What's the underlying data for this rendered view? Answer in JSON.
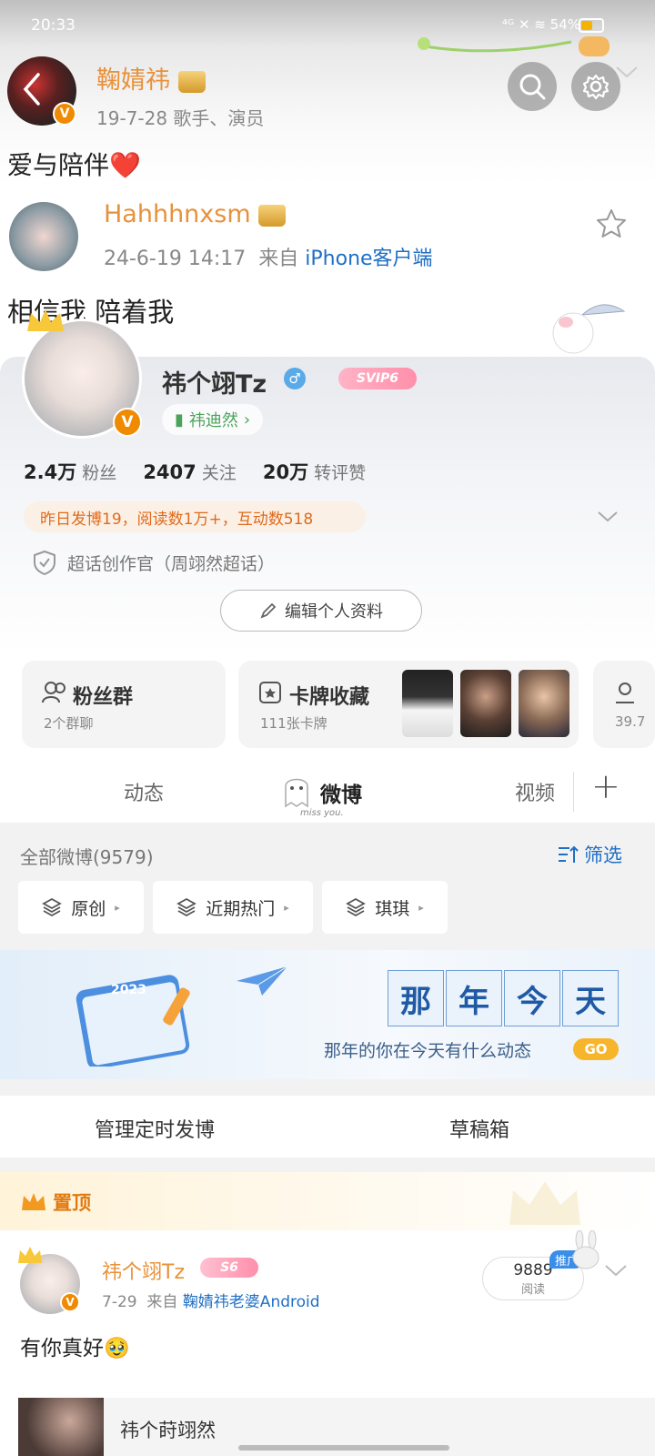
{
  "status_bar": {
    "time": "20:33",
    "indicators": "⁴ᴳ  ✕  ≋ 54%"
  },
  "header": {
    "user": {
      "name": "鞠婧祎",
      "meta": "19-7-28  歌手、演员",
      "avatar_icon": "avatar-photo"
    },
    "status_text": "爱与陪伴❤️"
  },
  "repost": {
    "user": {
      "name": "Hahhhnxsm",
      "date": "24-6-19 14:17",
      "source_prefix": "来自",
      "source": "iPhone客户端"
    },
    "text": "相信我 陪着我"
  },
  "profile": {
    "name": "祎个翊Tz",
    "gender_icon": "male",
    "vip_label": "SVIP6",
    "title_chip": "祎迪然",
    "stats": [
      {
        "num": "2.4万",
        "label": "粉丝"
      },
      {
        "num": "2407",
        "label": "关注"
      },
      {
        "num": "20万",
        "label": "转评赞"
      }
    ],
    "activity": "昨日发博19，阅读数1万+，互动数518",
    "role": "超话创作官（周翊然超话）",
    "edit_label": "编辑个人资料"
  },
  "cards": {
    "fans_group": {
      "title": "粉丝群",
      "sub": "2个群聊"
    },
    "card_collection": {
      "title": "卡牌收藏",
      "sub": "111张卡牌"
    },
    "partial_sub": "39.7"
  },
  "tabs": {
    "dynamic": "动态",
    "weibo": "微博",
    "weibo_sub": "miss you.",
    "video": "视频",
    "add": "+"
  },
  "filter": {
    "count_label": "全部微博(9579)",
    "filter_label": "筛选",
    "chips": [
      "原创",
      "近期热门",
      "琪琪"
    ]
  },
  "banner": {
    "year": "2023",
    "chars": [
      "那",
      "年",
      "今",
      "天"
    ],
    "subtitle": "那年的你在今天有什么动态",
    "go": "GO"
  },
  "manage": {
    "scheduled": "管理定时发博",
    "drafts": "草稿箱"
  },
  "pinned": {
    "label": "置顶",
    "post": {
      "name": "祎个翊Tz",
      "level": "S6",
      "date": "7-29",
      "source_prefix": "来自",
      "source": "鞠婧祎老婆Android",
      "reads": "9889",
      "reads_label": "阅读",
      "promo": "推广",
      "text": "有你真好🥹"
    },
    "next_preview": "祎个莳翊然"
  },
  "colors": {
    "accent_orange": "#e8913a",
    "link_blue": "#1f6fc4",
    "promo_blue": "#3b8ee8"
  }
}
